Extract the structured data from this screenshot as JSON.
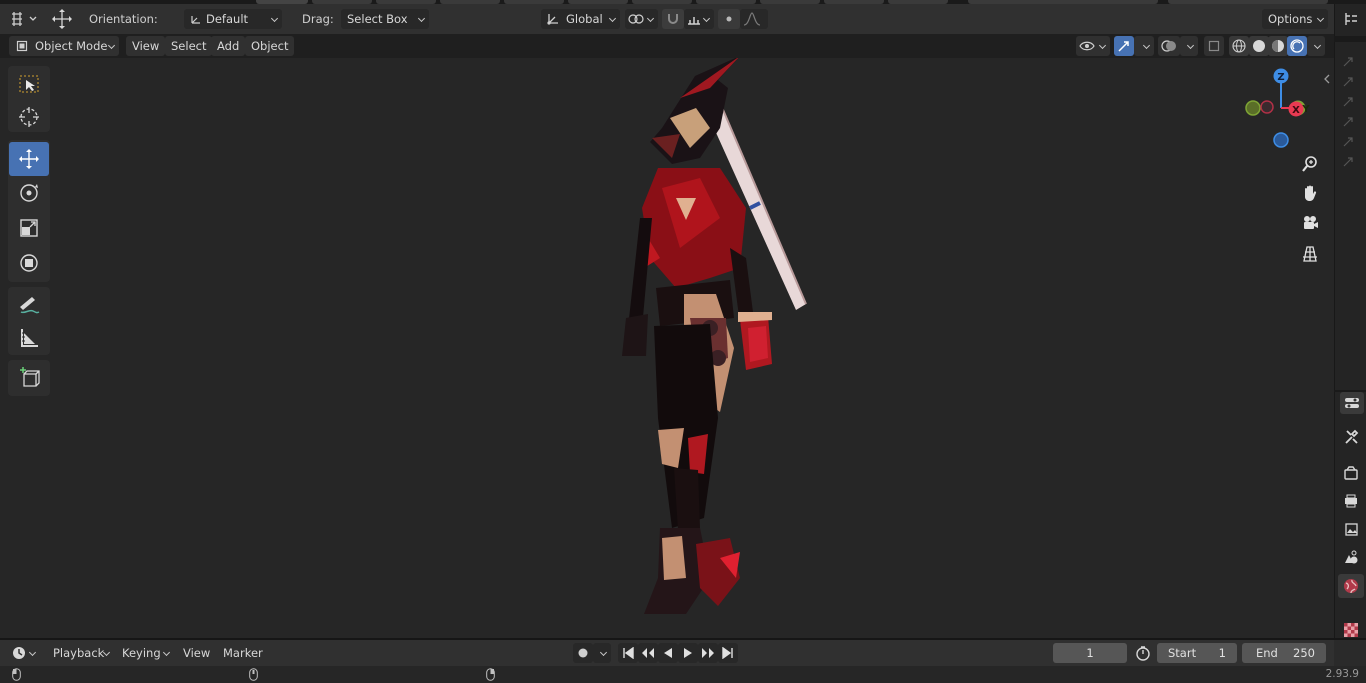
{
  "header": {
    "orientation_label": "Orientation:",
    "orientation_value": "Default",
    "drag_label": "Drag:",
    "drag_value": "Select Box",
    "transform_space": "Global",
    "options_label": "Options"
  },
  "viewport_header": {
    "mode": "Object Mode",
    "menus": [
      "View",
      "Select",
      "Add",
      "Object"
    ]
  },
  "gizmo": {
    "x": "X",
    "y": "Y",
    "z": "Z"
  },
  "timeline": {
    "menus": [
      "Playback",
      "Keying",
      "View",
      "Marker"
    ],
    "current_frame": "1",
    "start_label": "Start",
    "start_value": "1",
    "end_label": "End",
    "end_value": "250"
  },
  "status": {
    "version": "2.93.9"
  },
  "colors": {
    "accent": "#4772b3",
    "axis_x": "#e83a52",
    "axis_y": "#7ea434",
    "axis_z": "#3e8de5"
  }
}
